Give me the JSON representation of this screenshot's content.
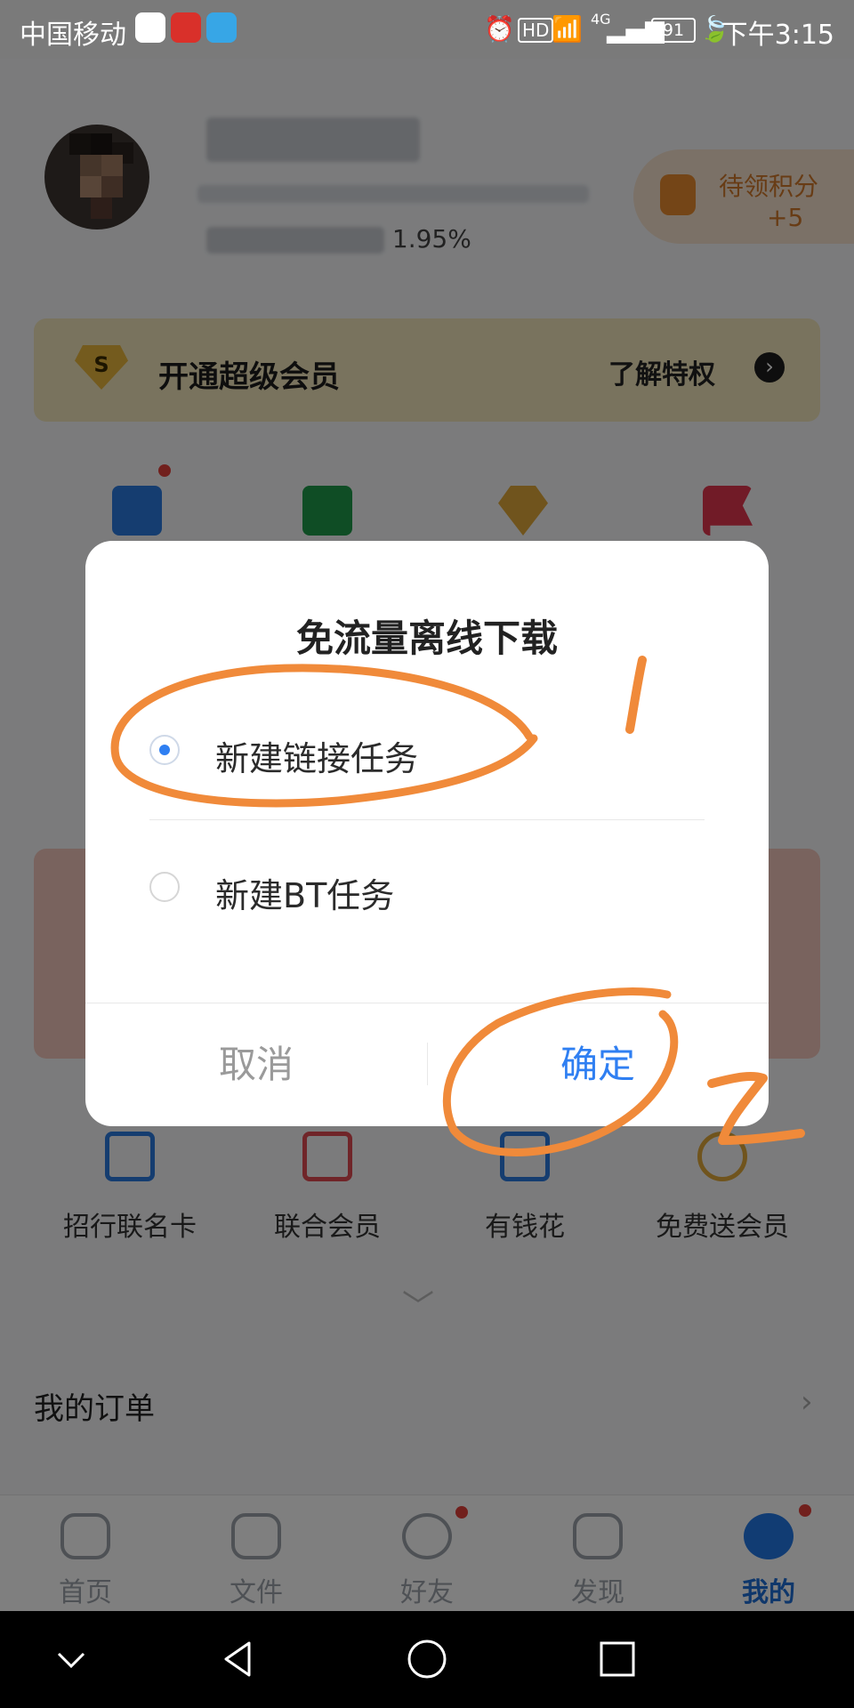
{
  "status_bar": {
    "carrier": "中国移动",
    "hd": "HD",
    "network": "4G",
    "battery": "91",
    "time": "下午3:15"
  },
  "profile": {
    "storage_text": "1.95%"
  },
  "points": {
    "label": "待领积分",
    "value": "+5"
  },
  "vip_banner": {
    "badge": "S",
    "title": "开通超级会员",
    "link": "了解特权"
  },
  "shortcuts_row2": [
    {
      "label": "招行联名卡",
      "icon": "card-icon"
    },
    {
      "label": "联合会员",
      "icon": "wallet-icon"
    },
    {
      "label": "有钱花",
      "icon": "money-icon"
    },
    {
      "label": "免费送会员",
      "icon": "gift-icon"
    }
  ],
  "orders": {
    "label": "我的订单"
  },
  "tabs": [
    {
      "label": "首页",
      "icon": "cloud-icon"
    },
    {
      "label": "文件",
      "icon": "folder-icon"
    },
    {
      "label": "好友",
      "icon": "friends-icon"
    },
    {
      "label": "发现",
      "icon": "discover-icon"
    },
    {
      "label": "我的",
      "icon": "me-icon"
    }
  ],
  "dialog": {
    "title": "免流量离线下载",
    "options": [
      {
        "label": "新建链接任务",
        "selected": true
      },
      {
        "label": "新建BT任务",
        "selected": false
      }
    ],
    "cancel_label": "取消",
    "confirm_label": "确定"
  },
  "annotations": {
    "step1": "1",
    "step2": "Z",
    "color": "#f08a3a"
  },
  "colors": {
    "accent": "#2f7ff2",
    "vip_bg": "#f3e6bd",
    "badge_red": "#e3403a"
  }
}
